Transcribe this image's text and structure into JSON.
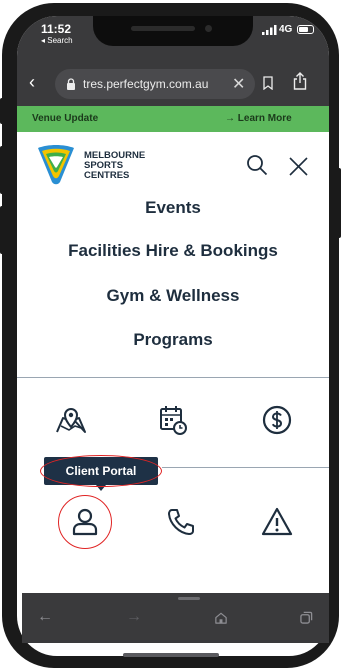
{
  "status_bar": {
    "time": "11:52",
    "back_app": "◂ Search",
    "network": "4G"
  },
  "browser": {
    "url": "tres.perfectgym.com.au",
    "close_glyph": "✕"
  },
  "venue_banner": {
    "title": "Venue Update",
    "link": "→ Learn More",
    "color": "#5cb85c"
  },
  "header": {
    "logo_lines": [
      "MELBOURNE",
      "SPORTS",
      "CENTRES"
    ]
  },
  "menu": {
    "items": [
      "Events",
      "Facilities Hire & Bookings",
      "Gym & Wellness",
      "Programs"
    ]
  },
  "quick_icons": {
    "row1": [
      "map-location-icon",
      "calendar-clock-icon",
      "dollar-icon"
    ],
    "row2": [
      "user-icon",
      "phone-icon",
      "warning-icon"
    ]
  },
  "tooltip": {
    "label": "Client Portal"
  },
  "colors": {
    "navy": "#1e2e3e",
    "tooltip_bg": "#1e3146",
    "annotation_red": "#e02424",
    "browser_chrome": "#3a3a3c"
  }
}
